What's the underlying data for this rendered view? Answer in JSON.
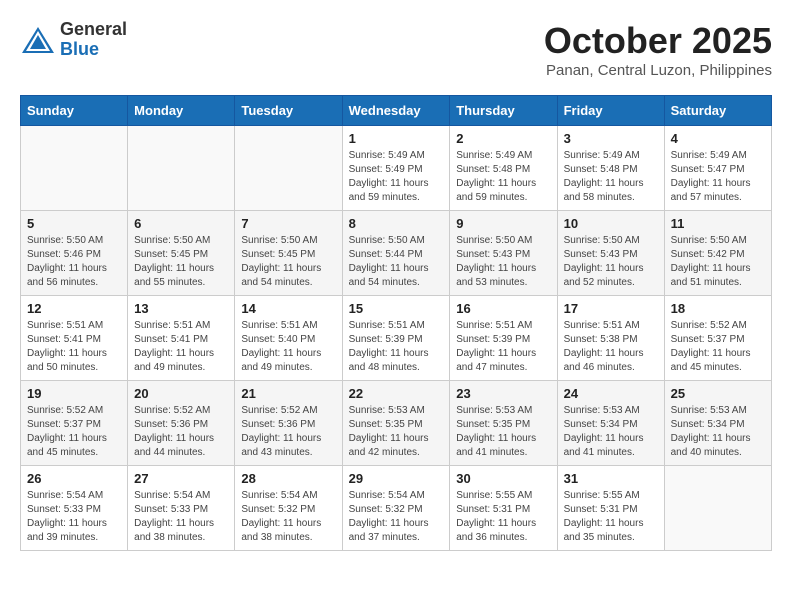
{
  "header": {
    "logo_general": "General",
    "logo_blue": "Blue",
    "month": "October 2025",
    "location": "Panan, Central Luzon, Philippines"
  },
  "days_of_week": [
    "Sunday",
    "Monday",
    "Tuesday",
    "Wednesday",
    "Thursday",
    "Friday",
    "Saturday"
  ],
  "weeks": [
    [
      {
        "day": "",
        "info": ""
      },
      {
        "day": "",
        "info": ""
      },
      {
        "day": "",
        "info": ""
      },
      {
        "day": "1",
        "info": "Sunrise: 5:49 AM\nSunset: 5:49 PM\nDaylight: 11 hours\nand 59 minutes."
      },
      {
        "day": "2",
        "info": "Sunrise: 5:49 AM\nSunset: 5:48 PM\nDaylight: 11 hours\nand 59 minutes."
      },
      {
        "day": "3",
        "info": "Sunrise: 5:49 AM\nSunset: 5:48 PM\nDaylight: 11 hours\nand 58 minutes."
      },
      {
        "day": "4",
        "info": "Sunrise: 5:49 AM\nSunset: 5:47 PM\nDaylight: 11 hours\nand 57 minutes."
      }
    ],
    [
      {
        "day": "5",
        "info": "Sunrise: 5:50 AM\nSunset: 5:46 PM\nDaylight: 11 hours\nand 56 minutes."
      },
      {
        "day": "6",
        "info": "Sunrise: 5:50 AM\nSunset: 5:45 PM\nDaylight: 11 hours\nand 55 minutes."
      },
      {
        "day": "7",
        "info": "Sunrise: 5:50 AM\nSunset: 5:45 PM\nDaylight: 11 hours\nand 54 minutes."
      },
      {
        "day": "8",
        "info": "Sunrise: 5:50 AM\nSunset: 5:44 PM\nDaylight: 11 hours\nand 54 minutes."
      },
      {
        "day": "9",
        "info": "Sunrise: 5:50 AM\nSunset: 5:43 PM\nDaylight: 11 hours\nand 53 minutes."
      },
      {
        "day": "10",
        "info": "Sunrise: 5:50 AM\nSunset: 5:43 PM\nDaylight: 11 hours\nand 52 minutes."
      },
      {
        "day": "11",
        "info": "Sunrise: 5:50 AM\nSunset: 5:42 PM\nDaylight: 11 hours\nand 51 minutes."
      }
    ],
    [
      {
        "day": "12",
        "info": "Sunrise: 5:51 AM\nSunset: 5:41 PM\nDaylight: 11 hours\nand 50 minutes."
      },
      {
        "day": "13",
        "info": "Sunrise: 5:51 AM\nSunset: 5:41 PM\nDaylight: 11 hours\nand 49 minutes."
      },
      {
        "day": "14",
        "info": "Sunrise: 5:51 AM\nSunset: 5:40 PM\nDaylight: 11 hours\nand 49 minutes."
      },
      {
        "day": "15",
        "info": "Sunrise: 5:51 AM\nSunset: 5:39 PM\nDaylight: 11 hours\nand 48 minutes."
      },
      {
        "day": "16",
        "info": "Sunrise: 5:51 AM\nSunset: 5:39 PM\nDaylight: 11 hours\nand 47 minutes."
      },
      {
        "day": "17",
        "info": "Sunrise: 5:51 AM\nSunset: 5:38 PM\nDaylight: 11 hours\nand 46 minutes."
      },
      {
        "day": "18",
        "info": "Sunrise: 5:52 AM\nSunset: 5:37 PM\nDaylight: 11 hours\nand 45 minutes."
      }
    ],
    [
      {
        "day": "19",
        "info": "Sunrise: 5:52 AM\nSunset: 5:37 PM\nDaylight: 11 hours\nand 45 minutes."
      },
      {
        "day": "20",
        "info": "Sunrise: 5:52 AM\nSunset: 5:36 PM\nDaylight: 11 hours\nand 44 minutes."
      },
      {
        "day": "21",
        "info": "Sunrise: 5:52 AM\nSunset: 5:36 PM\nDaylight: 11 hours\nand 43 minutes."
      },
      {
        "day": "22",
        "info": "Sunrise: 5:53 AM\nSunset: 5:35 PM\nDaylight: 11 hours\nand 42 minutes."
      },
      {
        "day": "23",
        "info": "Sunrise: 5:53 AM\nSunset: 5:35 PM\nDaylight: 11 hours\nand 41 minutes."
      },
      {
        "day": "24",
        "info": "Sunrise: 5:53 AM\nSunset: 5:34 PM\nDaylight: 11 hours\nand 41 minutes."
      },
      {
        "day": "25",
        "info": "Sunrise: 5:53 AM\nSunset: 5:34 PM\nDaylight: 11 hours\nand 40 minutes."
      }
    ],
    [
      {
        "day": "26",
        "info": "Sunrise: 5:54 AM\nSunset: 5:33 PM\nDaylight: 11 hours\nand 39 minutes."
      },
      {
        "day": "27",
        "info": "Sunrise: 5:54 AM\nSunset: 5:33 PM\nDaylight: 11 hours\nand 38 minutes."
      },
      {
        "day": "28",
        "info": "Sunrise: 5:54 AM\nSunset: 5:32 PM\nDaylight: 11 hours\nand 38 minutes."
      },
      {
        "day": "29",
        "info": "Sunrise: 5:54 AM\nSunset: 5:32 PM\nDaylight: 11 hours\nand 37 minutes."
      },
      {
        "day": "30",
        "info": "Sunrise: 5:55 AM\nSunset: 5:31 PM\nDaylight: 11 hours\nand 36 minutes."
      },
      {
        "day": "31",
        "info": "Sunrise: 5:55 AM\nSunset: 5:31 PM\nDaylight: 11 hours\nand 35 minutes."
      },
      {
        "day": "",
        "info": ""
      }
    ]
  ]
}
